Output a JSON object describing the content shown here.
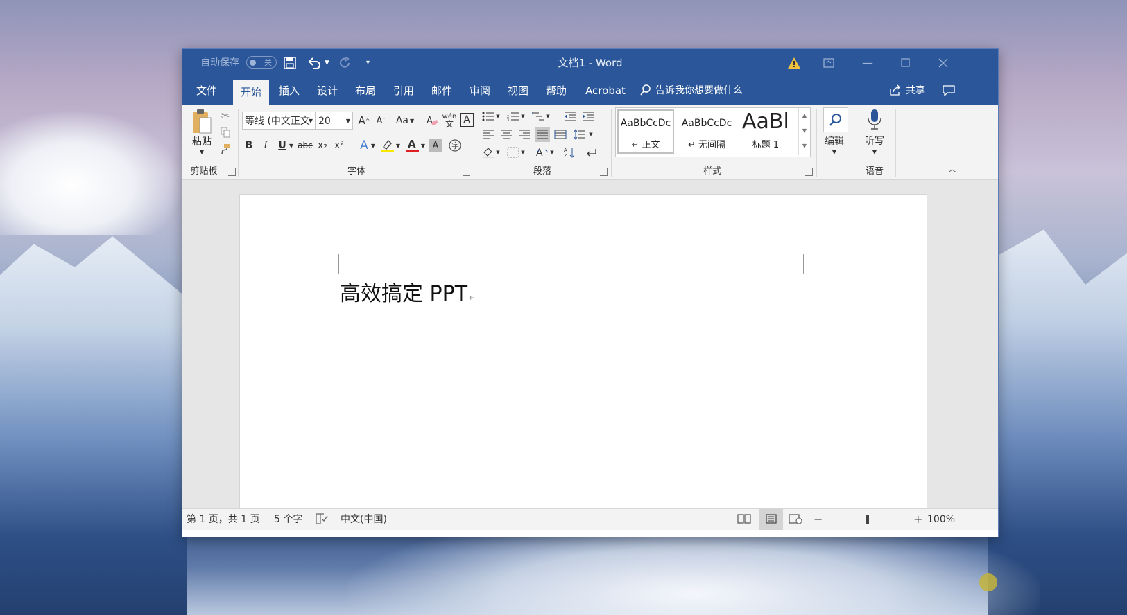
{
  "app": {
    "autosave_label": "自动保存",
    "autosave_state": "关",
    "title": "文档1  -  Word"
  },
  "tabs": [
    "文件",
    "开始",
    "插入",
    "设计",
    "布局",
    "引用",
    "邮件",
    "审阅",
    "视图",
    "帮助",
    "Acrobat"
  ],
  "tell_me": "告诉我你想要做什么",
  "share_label": "共享",
  "ribbon": {
    "clipboard": {
      "paste_label": "粘贴",
      "group_label": "剪贴板"
    },
    "font": {
      "font_name": "等线 (中文正文",
      "font_size": "20",
      "case_label": "Aa",
      "group_label": "字体",
      "bold": "B",
      "italic": "I",
      "underline": "U",
      "strike": "abc",
      "sub": "x₂",
      "sup": "x²",
      "phonetic": "wén",
      "enclosed": "A"
    },
    "paragraph": {
      "group_label": "段落"
    },
    "styles": {
      "items": [
        {
          "preview": "AaBbCcDc",
          "name": "↵ 正文"
        },
        {
          "preview": "AaBbCcDc",
          "name": "↵ 无间隔"
        },
        {
          "preview": "AaBl",
          "name": "标题 1"
        }
      ],
      "group_label": "样式"
    },
    "editing": {
      "label": "编辑"
    },
    "voice": {
      "label": "听写",
      "group_label": "语音"
    }
  },
  "document": {
    "text": "高效搞定 PPT",
    "para_mark": "↵"
  },
  "status": {
    "page": "第 1 页，共 1 页",
    "words": "5 个字",
    "language": "中文(中国)",
    "zoom": "100%"
  },
  "zoom_level": 1.0,
  "colors": {
    "word_blue": "#2b579a",
    "ribbon_bg": "#f3f3f3",
    "warning": "#f0c040",
    "font_color_bar": "#e02020",
    "highlight_bar": "#f8e800"
  }
}
